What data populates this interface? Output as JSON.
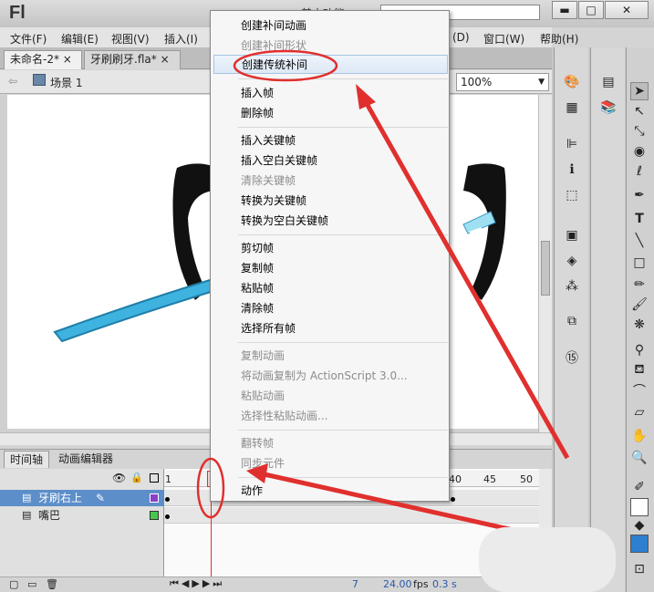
{
  "app": {
    "logo": "Fl",
    "workspace_label": "基本功能"
  },
  "menubar": [
    "文件(F)",
    "编辑(E)",
    "视图(V)",
    "插入(I)",
    "(D)",
    "窗口(W)",
    "帮助(H)"
  ],
  "tabs": [
    "未命名-2*",
    "牙刷刷牙.fla*"
  ],
  "breadcrumb": {
    "scene": "场景 1"
  },
  "zoom": "100%",
  "timeline": {
    "tabs": [
      "时间轴",
      "动画编辑器"
    ],
    "ruler": [
      "1",
      "40",
      "45",
      "50"
    ],
    "layers": [
      {
        "name": "牙刷右上"
      },
      {
        "name": "嘴巴"
      }
    ],
    "status": {
      "frame": "7",
      "fps": "24.00",
      "fps_unit": "fps",
      "time": "0.3 s"
    }
  },
  "context_menu": {
    "groups": [
      [
        {
          "label": "创建补间动画",
          "enabled": true
        },
        {
          "label": "创建补间形状",
          "enabled": false
        },
        {
          "label": "创建传统补间",
          "enabled": true,
          "highlighted": true
        }
      ],
      [
        {
          "label": "插入帧",
          "enabled": true
        },
        {
          "label": "删除帧",
          "enabled": true
        }
      ],
      [
        {
          "label": "插入关键帧",
          "enabled": true
        },
        {
          "label": "插入空白关键帧",
          "enabled": true
        },
        {
          "label": "清除关键帧",
          "enabled": false
        },
        {
          "label": "转换为关键帧",
          "enabled": true
        },
        {
          "label": "转换为空白关键帧",
          "enabled": true
        }
      ],
      [
        {
          "label": "剪切帧",
          "enabled": true
        },
        {
          "label": "复制帧",
          "enabled": true
        },
        {
          "label": "粘贴帧",
          "enabled": true
        },
        {
          "label": "清除帧",
          "enabled": true
        },
        {
          "label": "选择所有帧",
          "enabled": true
        }
      ],
      [
        {
          "label": "复制动画",
          "enabled": false
        },
        {
          "label": "将动画复制为 ActionScript 3.0...",
          "enabled": false
        },
        {
          "label": "粘贴动画",
          "enabled": false
        },
        {
          "label": "选择性粘贴动画...",
          "enabled": false
        }
      ],
      [
        {
          "label": "翻转帧",
          "enabled": false
        },
        {
          "label": "同步元件",
          "enabled": false
        }
      ],
      [
        {
          "label": "动作",
          "enabled": true
        }
      ]
    ]
  },
  "colors": {
    "accent_red": "#e0302e",
    "highlight": "#dde9f6",
    "panel": "#d4d4d4",
    "toothbrush": "#3fb3e0"
  },
  "icons": [
    "selection-tool-icon",
    "subselection-tool-icon",
    "free-transform-icon",
    "3d-rotation-icon",
    "lasso-icon",
    "pen-icon",
    "text-icon",
    "line-icon",
    "rectangle-icon",
    "pencil-icon",
    "brush-icon",
    "deco-icon",
    "bone-icon",
    "paint-bucket-icon",
    "eyedropper-icon",
    "eraser-icon",
    "hand-icon",
    "zoom-icon"
  ]
}
